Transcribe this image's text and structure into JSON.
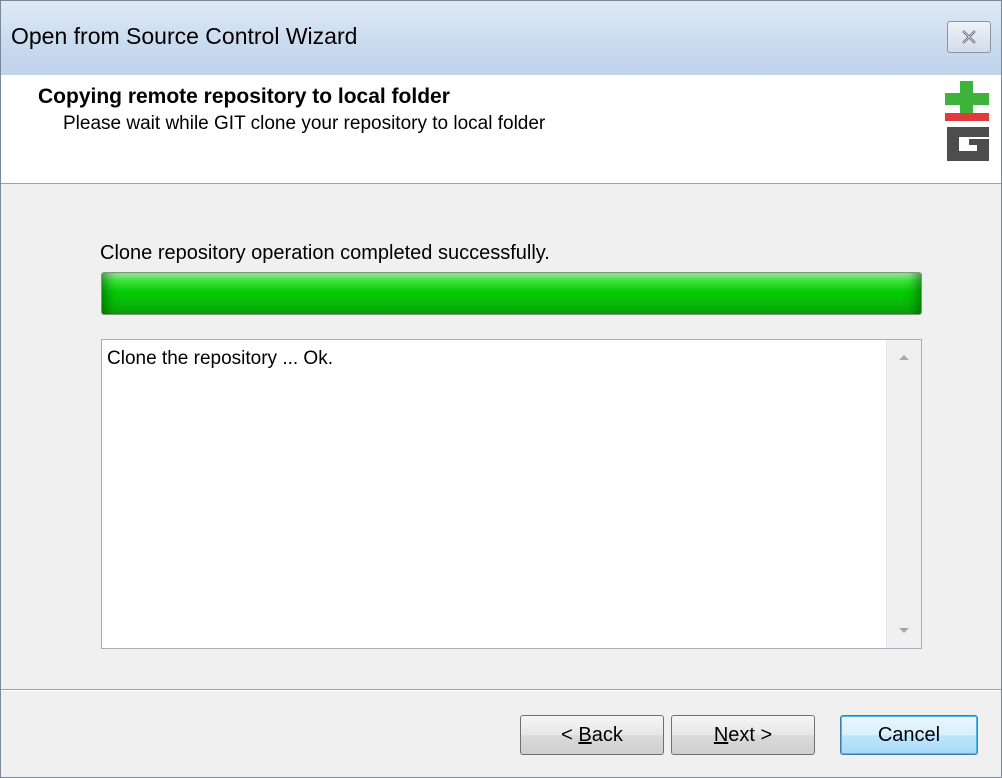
{
  "window": {
    "title": "Open from Source Control Wizard",
    "close_icon": "close-icon"
  },
  "header": {
    "title": "Copying remote repository to local folder",
    "subtitle": "Please wait while GIT clone your repository to local folder",
    "logo": "git-plus-logo",
    "logo_text": "GIT"
  },
  "main": {
    "status_text": "Clone repository operation completed successfully.",
    "progress_value": 1.0,
    "progress_color": "#06cc06",
    "log_text": "Clone the repository ... Ok.",
    "scroll_up_icon": "scroll-up-arrow-icon",
    "scroll_down_icon": "scroll-down-arrow-icon"
  },
  "footer": {
    "back_prefix": "< ",
    "back_accel": "B",
    "back_rest": "ack",
    "next_accel": "N",
    "next_rest": "ext >",
    "cancel_label": "Cancel"
  }
}
